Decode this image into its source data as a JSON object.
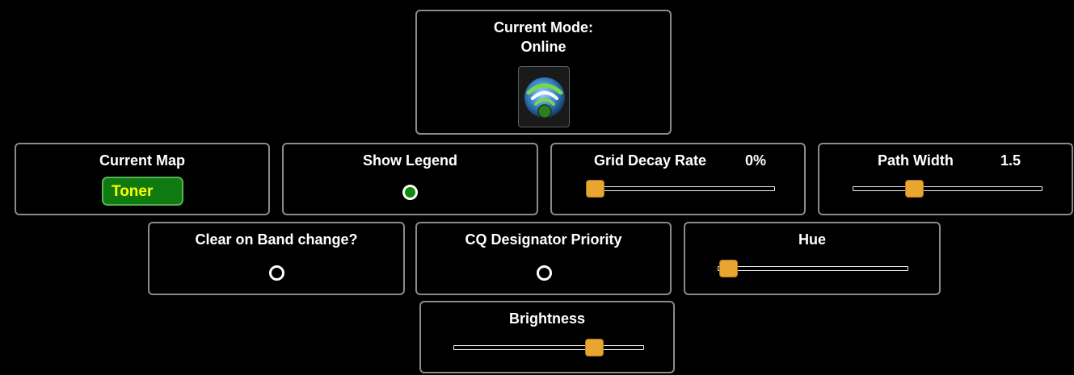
{
  "mode": {
    "title": "Current Mode:",
    "value": "Online",
    "icon": "wifi-globe-icon"
  },
  "map": {
    "title": "Current Map",
    "value": "Toner"
  },
  "legend": {
    "title": "Show Legend",
    "checked": true
  },
  "grid_decay": {
    "title": "Grid Decay Rate",
    "value_label": "0%",
    "level": 0
  },
  "path_width": {
    "title": "Path Width",
    "value_label": "1.5",
    "level": 0.32
  },
  "clear_band": {
    "title": "Clear on Band change?",
    "checked": false
  },
  "cq_priority": {
    "title": "CQ Designator Priority",
    "checked": false
  },
  "hue": {
    "title": "Hue",
    "level": 0
  },
  "brightness": {
    "title": "Brightness",
    "level": 0.75
  },
  "colors": {
    "background": "#000000",
    "border": "#8a8a8a",
    "accent_green": "#0f7a0f",
    "map_text": "#ffff00",
    "slider_thumb": "#e8a530"
  }
}
